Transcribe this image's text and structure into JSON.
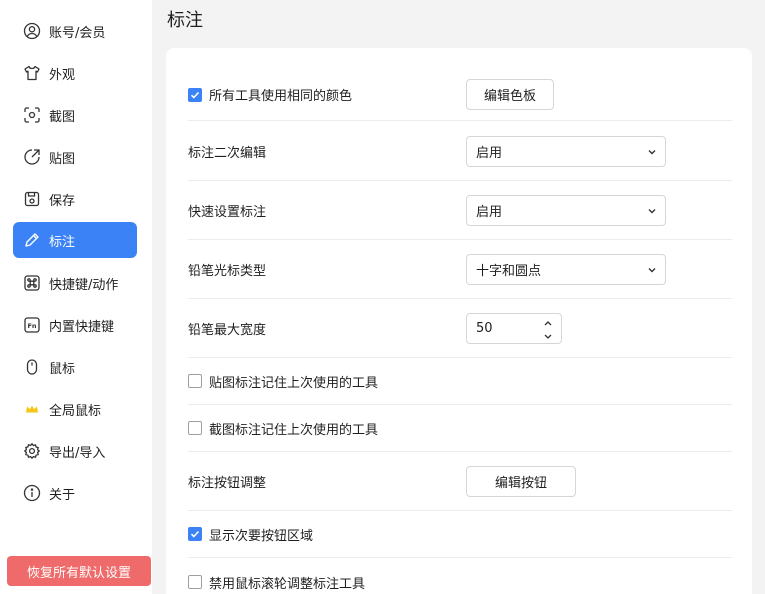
{
  "sidebar": {
    "items": [
      {
        "label": "账号/会员",
        "icon": "user-icon",
        "active": false
      },
      {
        "label": "外观",
        "icon": "shirt-icon",
        "active": false
      },
      {
        "label": "截图",
        "icon": "screenshot-icon",
        "active": false
      },
      {
        "label": "贴图",
        "icon": "pin-icon",
        "active": false
      },
      {
        "label": "保存",
        "icon": "save-icon",
        "active": false
      },
      {
        "label": "标注",
        "icon": "pencil-icon",
        "active": true
      },
      {
        "label": "快捷键/动作",
        "icon": "command-icon",
        "active": false
      },
      {
        "label": "内置快捷键",
        "icon": "fn-key-icon",
        "active": false
      },
      {
        "label": "鼠标",
        "icon": "mouse-icon",
        "active": false
      },
      {
        "label": "全局鼠标",
        "icon": "crown-icon",
        "active": false
      },
      {
        "label": "导出/导入",
        "icon": "gear-icon",
        "active": false
      },
      {
        "label": "关于",
        "icon": "info-icon",
        "active": false
      }
    ],
    "reset_label": "恢复所有默认设置"
  },
  "main": {
    "title": "标注",
    "rows": [
      {
        "label": "所有工具使用相同的颜色",
        "checkbox": true,
        "checked": true,
        "button": "编辑色板"
      },
      {
        "label": "标注二次编辑",
        "select": "启用"
      },
      {
        "label": "快速设置标注",
        "select": "启用"
      },
      {
        "label": "铅笔光标类型",
        "select": "十字和圆点"
      },
      {
        "label": "铅笔最大宽度",
        "spin": "50"
      },
      {
        "label": "贴图标注记住上次使用的工具",
        "checkbox": true,
        "checked": false
      },
      {
        "label": "截图标注记住上次使用的工具",
        "checkbox": true,
        "checked": false
      },
      {
        "label": "标注按钮调整",
        "button": "编辑按钮"
      },
      {
        "label": "显示次要按钮区域",
        "checkbox": true,
        "checked": true
      },
      {
        "label": "禁用鼠标滚轮调整标注工具",
        "checkbox": true,
        "checked": false
      }
    ]
  },
  "colors": {
    "accent": "#3b82f6",
    "danger": "#ef6a6a"
  }
}
